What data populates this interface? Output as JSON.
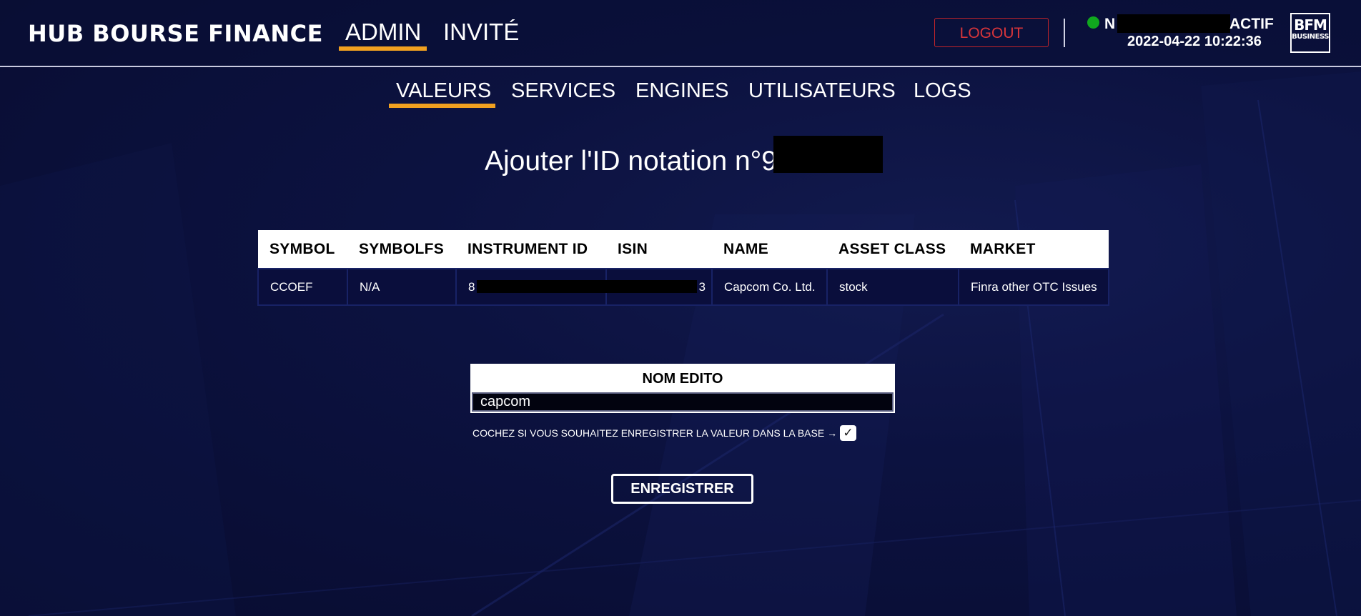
{
  "header": {
    "brand": "HUB BOURSE FINANCE",
    "nav": [
      {
        "label": "ADMIN",
        "active": true
      },
      {
        "label": "INVITÉ",
        "active": false
      }
    ],
    "logout_label": "LOGOUT",
    "user": {
      "initial": "N",
      "status_text": "ACTIF",
      "status_color": "#10a81e",
      "datetime": "2022-04-22 10:22:36"
    },
    "logo": {
      "line1": "BFM",
      "line2": "BUSINESS"
    }
  },
  "subnav": [
    {
      "label": "VALEURS",
      "active": true
    },
    {
      "label": "SERVICES",
      "active": false
    },
    {
      "label": "ENGINES",
      "active": false
    },
    {
      "label": "UTILISATEURS",
      "active": false
    },
    {
      "label": "LOGS",
      "active": false
    }
  ],
  "page_title": "Ajouter l'ID notation n°9",
  "table": {
    "columns": [
      "SYMBOL",
      "SYMBOLFS",
      "INSTRUMENT ID",
      "ISIN",
      "NAME",
      "ASSET CLASS",
      "MARKET"
    ],
    "row": {
      "symbol": "CCOEF",
      "symbolfs": "N/A",
      "instrument_id_start": "8",
      "isin_end": "3",
      "name": "Capcom Co. Ltd.",
      "asset_class": "stock",
      "market": "Finra other OTC Issues"
    }
  },
  "form": {
    "label": "NOM EDITO",
    "value": "capcom",
    "checkbox_label": "COCHEZ SI VOUS SOUHAITEZ ENREGISTRER LA VALEUR DANS LA BASE →",
    "checkbox_mark": "✓",
    "checkbox_checked": true,
    "submit_label": "ENREGISTRER"
  },
  "colors": {
    "accent": "#f0a020",
    "background": "#0c1240",
    "logout": "#d8353a"
  }
}
